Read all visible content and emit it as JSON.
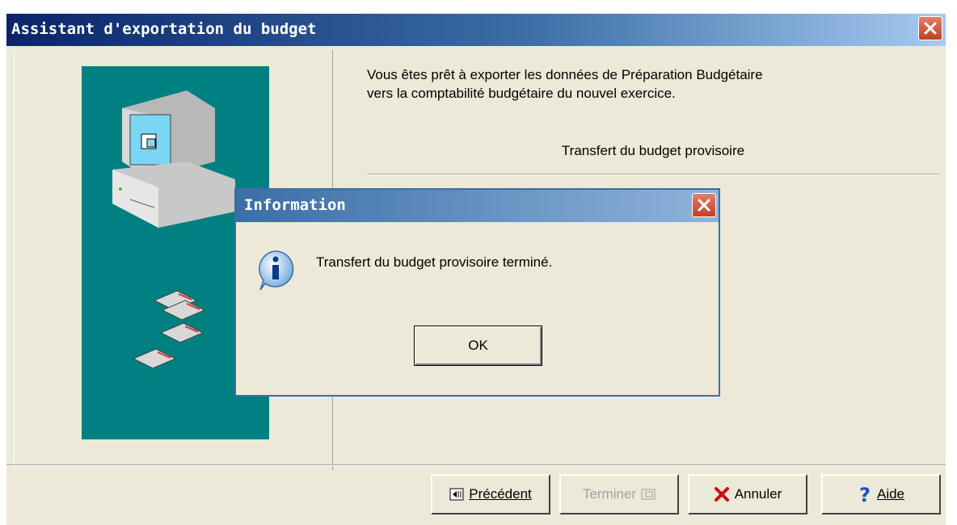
{
  "window": {
    "title": "Assistant d'exportation du budget"
  },
  "wizard": {
    "intro_line1": "Vous êtes prêt à exporter les données de Préparation Budgétaire",
    "intro_line2": "vers la comptabilité budgétaire du nouvel exercice.",
    "subtitle": "Transfert du budget provisoire"
  },
  "buttons": {
    "previous": "Précédent",
    "finish": "Terminer",
    "cancel": "Annuler",
    "help": "Aide"
  },
  "dialog": {
    "title": "Information",
    "message": "Transfert du budget provisoire terminé.",
    "ok": "OK"
  },
  "colors": {
    "teal_panel": "#008080",
    "title_bar": "#0a246a",
    "window_bg": "#ece9d8"
  },
  "icons": [
    "close-icon",
    "computer-icon",
    "floppy-icon",
    "info-icon",
    "back-icon",
    "finish-icon",
    "cancel-x-icon",
    "help-question-icon"
  ]
}
